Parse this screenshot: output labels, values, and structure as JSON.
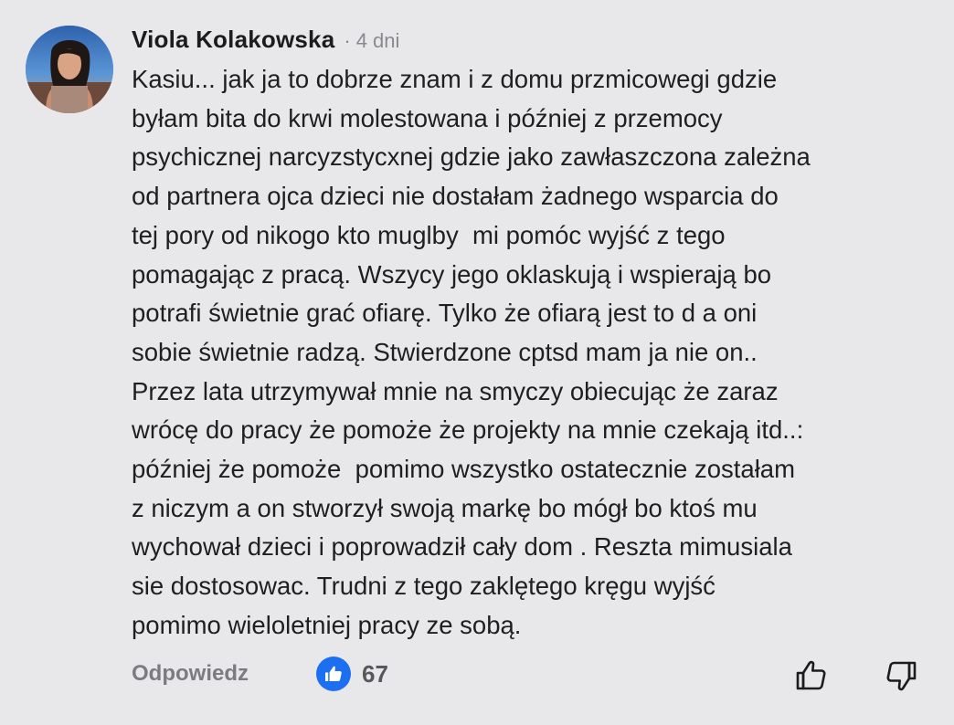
{
  "comment": {
    "author": "Viola Kolakowska",
    "separator": "·",
    "time": "4 dni",
    "avatar_icon": "profile-photo",
    "lines": [
      "Kasiu... jak ja to dobrze znam i z domu przmicowegi gdzie",
      "byłam bita do krwi molestowana i później z przemocy",
      "psychicznej narcyzstycxnej gdzie jako zawłaszczona zależna",
      "od partnera ojca dzieci nie dostałam żadnego wsparcia do",
      "tej pory od nikogo kto muglby  mi pomóc wyjść z tego",
      "pomagając z pracą. Wszycy jego oklaskują i wspierają bo",
      "potrafi świetnie grać ofiarę. Tylko że ofiarą jest to d a oni",
      "sobie świetnie radzą. Stwierdzone cptsd mam ja nie on..",
      "Przez lata utrzymywał mnie na smyczy obiecując że zaraz",
      "wrócę do pracy że pomoże że projekty na mnie czekają itd..:",
      "później że pomoże  pomimo wszystko ostatecznie zostałam",
      "z niczym a on stworzył swoją markę bo mógł bo ktoś mu",
      "wychował dzieci i poprowadził cały dom . Reszta mimusiala",
      "sie dostosowac. Trudni z tego zaklętego kręgu wyjść",
      "pomimo wieloletniej pracy ze sobą."
    ]
  },
  "actions": {
    "reply_label": "Odpowiedz",
    "like_count": "67",
    "like_icon": "thumbs-up-icon",
    "upvote_icon": "thumbs-up-outline-icon",
    "downvote_icon": "thumbs-down-outline-icon"
  },
  "colors": {
    "background": "#e8e8ea",
    "like_blue": "#1b6ff0",
    "muted_text": "#7b7b80"
  }
}
